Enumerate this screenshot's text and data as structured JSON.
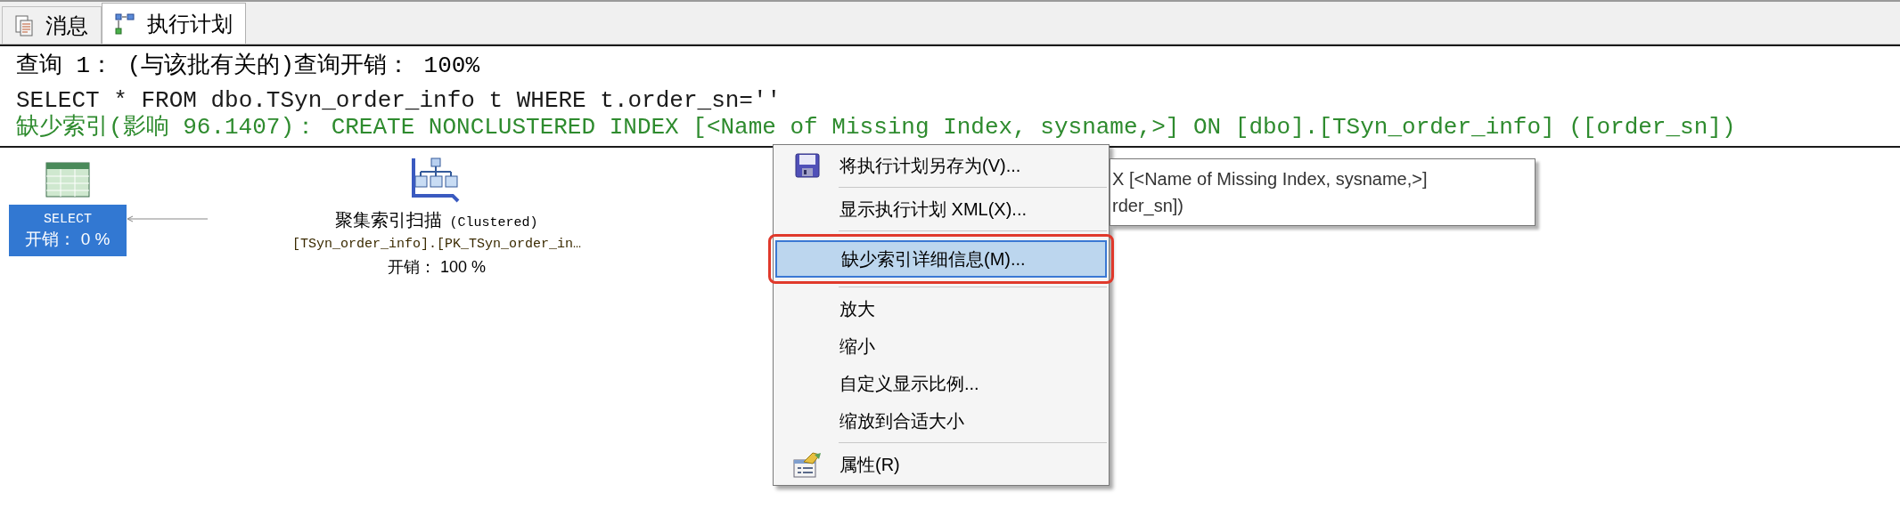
{
  "tabs": [
    {
      "kind": "messages",
      "label": "消息",
      "selected": false
    },
    {
      "kind": "plan",
      "label": "执行计划",
      "selected": true
    }
  ],
  "query_header": "查询 1： (与该批有关的)查询开销： 100%",
  "sql": "SELECT * FROM dbo.TSyn_order_info t WHERE t.order_sn=''",
  "missing_index": "缺少索引(影响 96.1407)： CREATE NONCLUSTERED INDEX [<Name of Missing Index, sysname,>] ON [dbo].[TSyn_order_info] ([order_sn])",
  "nodes": [
    {
      "kind": "select",
      "label": "SELECT",
      "cost": "开销： 0 %",
      "selected": true
    },
    {
      "kind": "clustered_index_scan",
      "label": "聚集索引扫描",
      "label_suffix": "(Clustered)",
      "object": "[TSyn_order_info].[PK_TSyn_order_in…",
      "cost": "开销： 100 %",
      "selected": false
    }
  ],
  "context_menu": [
    {
      "kind": "save",
      "label": "将执行计划另存为(V)...",
      "selected": false,
      "outlined": false
    },
    {
      "kind": "separator"
    },
    {
      "kind": "item",
      "label": "显示执行计划 XML(X)...",
      "selected": false,
      "outlined": false
    },
    {
      "kind": "separator"
    },
    {
      "kind": "item",
      "label": "缺少索引详细信息(M)...",
      "selected": true,
      "outlined": true
    },
    {
      "kind": "separator"
    },
    {
      "kind": "item",
      "label": "放大",
      "selected": false,
      "outlined": false
    },
    {
      "kind": "item",
      "label": "缩小",
      "selected": false,
      "outlined": false
    },
    {
      "kind": "item",
      "label": "自定义显示比例...",
      "selected": false,
      "outlined": false
    },
    {
      "kind": "item",
      "label": "缩放到合适大小",
      "selected": false,
      "outlined": false
    },
    {
      "kind": "separator"
    },
    {
      "kind": "properties",
      "label": "属性(R)",
      "selected": false,
      "outlined": false
    }
  ],
  "tooltip": [
    "X [<Name of Missing Index, sysname,>]",
    "rder_sn])"
  ]
}
